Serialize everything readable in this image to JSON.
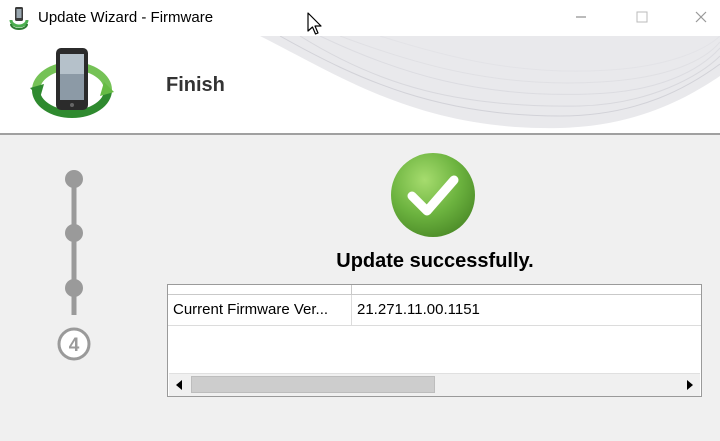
{
  "window": {
    "title": "Update Wizard - Firmware",
    "controls": [
      "minimize-icon",
      "maximize-icon",
      "close-icon"
    ]
  },
  "header": {
    "title": "Finish",
    "icon": "phone-sync-icon"
  },
  "steps": {
    "current_step": "4",
    "total_steps": 4
  },
  "result": {
    "icon": "checkmark-icon",
    "message": "Update successfully.",
    "accent_color": "#6cb33f"
  },
  "table": {
    "rows": [
      {
        "name": "Current Firmware Ver...",
        "value": "21.271.11.00.1151"
      }
    ]
  }
}
